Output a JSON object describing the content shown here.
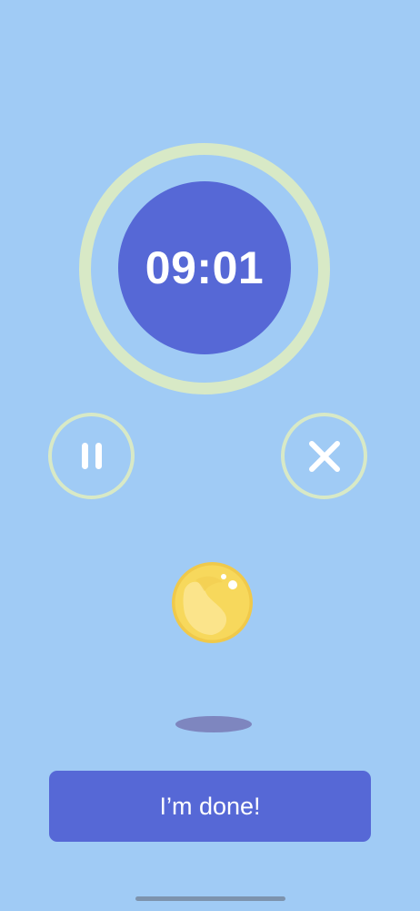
{
  "timer": {
    "display": "09:01"
  },
  "controls": {
    "pause_icon": "pause-icon",
    "close_icon": "close-icon"
  },
  "coin": {
    "icon": "coin-icon"
  },
  "done_button": {
    "label": "I’m done!"
  },
  "colors": {
    "background": "#a0cbf5",
    "accent": "#5668d6",
    "ring": "#d8e9c6",
    "coin": "#f7d85c",
    "shadow": "#7e86bf"
  }
}
